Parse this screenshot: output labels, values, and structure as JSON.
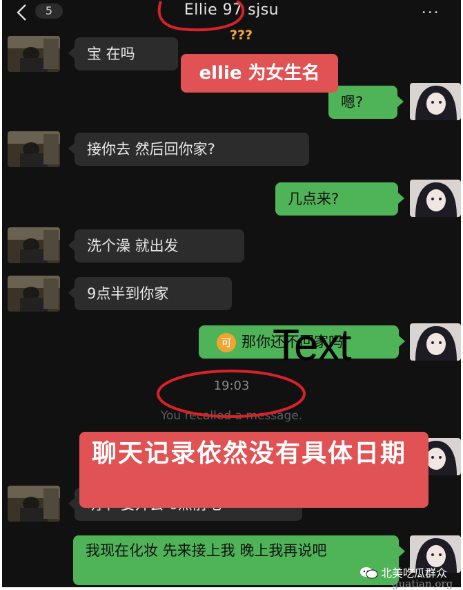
{
  "header": {
    "badge": "5",
    "title": "Ellie 97 sjsu",
    "more": "•••"
  },
  "annotations": {
    "question_marks": "???",
    "label_female_name": "ellie 为女生名",
    "overlay_text": "Text",
    "label_no_date": "聊天记录依然没有具体日期"
  },
  "messages": [
    {
      "side": "left",
      "text": "宝 在吗"
    },
    {
      "side": "right",
      "text": "嗯?"
    },
    {
      "side": "left",
      "text": "接你去 然后回你家?"
    },
    {
      "side": "right",
      "text": "几点来?"
    },
    {
      "side": "left",
      "text": "洗个澡 就出发"
    },
    {
      "side": "left",
      "text": "9点半到你家"
    },
    {
      "side": "right",
      "text": "那你还不回家吗",
      "icon": "可"
    },
    {
      "side": "left",
      "text": "明早 要开会 6点前吧"
    },
    {
      "side": "right",
      "text": "我现在化妆 先来接上我 晚上我再说吧"
    }
  ],
  "system": {
    "time": "19:03",
    "recall": "You recalled a message."
  },
  "watermark": {
    "line1": "北美吃瓜群众",
    "line2": "guatian.org"
  },
  "colors": {
    "background": "#111111",
    "bubble_left": "#2c2c2c",
    "bubble_right": "#4fb357",
    "annotation_red": "#e15255",
    "circle_red": "#d8222a"
  }
}
